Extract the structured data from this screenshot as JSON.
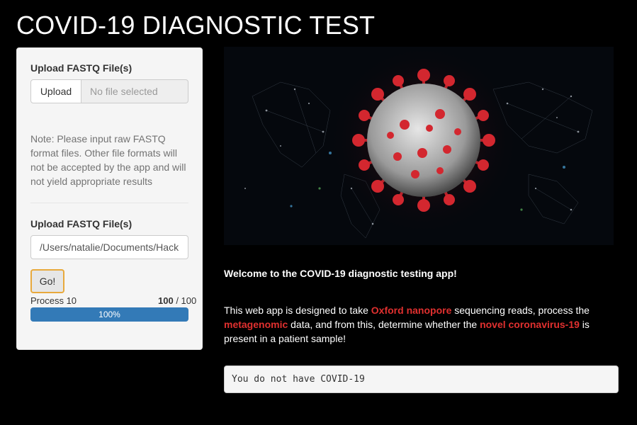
{
  "app": {
    "title": "COVID-19 DIAGNOSTIC TEST"
  },
  "sidebar": {
    "upload1": {
      "label": "Upload FASTQ File(s)",
      "button": "Upload",
      "placeholder": "No file selected"
    },
    "note": "Note: Please input raw FASTQ format files. Other file formats will not be accepted by the app and will not yield appropriate results",
    "upload2": {
      "label": "Upload FASTQ File(s)",
      "value": "/Users/natalie/Documents/Hack"
    },
    "go_button": "Go!",
    "progress": {
      "label": "Process 10",
      "current": "100",
      "separator": " / ",
      "total": "100",
      "percent_text": "100%",
      "fraction": 1.0
    }
  },
  "main": {
    "hero_image": "coronavirus-world-map-image",
    "welcome": "Welcome to the COVID-19 diagnostic testing app!",
    "description": {
      "t1": "This web app is designed to take ",
      "h1": "Oxford nanopore",
      "t2": " sequencing reads, process the ",
      "h2": "metagenomic",
      "t3": " data, and from this, determine whether the ",
      "h3": "novel coronavirus-19",
      "t4": " is present in a patient sample!"
    },
    "result": "You do not have COVID-19"
  },
  "colors": {
    "highlight": "#e0302f",
    "progress": "#337ab7",
    "go_focus": "#e8a93c"
  }
}
